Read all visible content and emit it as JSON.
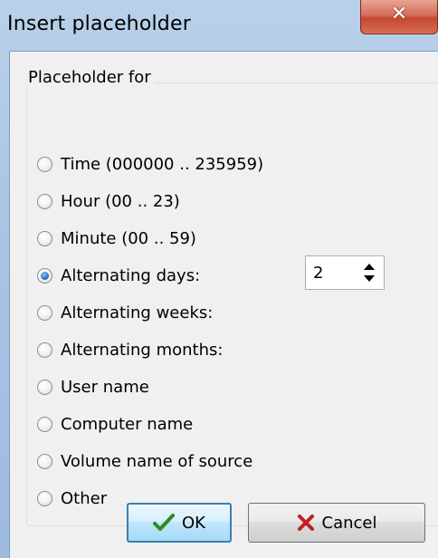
{
  "window": {
    "title": "Insert placeholder",
    "close_icon": "close-icon"
  },
  "group": {
    "title": "Placeholder for"
  },
  "options": [
    {
      "label": "Time (000000 .. 235959)",
      "checked": false
    },
    {
      "label": "Hour (00 .. 23)",
      "checked": false
    },
    {
      "label": "Minute (00 .. 59)",
      "checked": false
    },
    {
      "label": "Alternating days:",
      "checked": true
    },
    {
      "label": "Alternating weeks:",
      "checked": false
    },
    {
      "label": "Alternating months:",
      "checked": false
    },
    {
      "label": "User name",
      "checked": false
    },
    {
      "label": "Computer name",
      "checked": false
    },
    {
      "label": "Volume name of source",
      "checked": false
    },
    {
      "label": "Other",
      "checked": false
    }
  ],
  "spinner": {
    "value": "2"
  },
  "buttons": {
    "ok_label": "OK",
    "ok_icon": "checkmark-icon",
    "cancel_label": "Cancel",
    "cancel_icon": "red-x-icon"
  },
  "colors": {
    "ok_check": "#2e8b1f",
    "cancel_x": "#c0201b",
    "radio_selected": "#2a6fc0"
  }
}
